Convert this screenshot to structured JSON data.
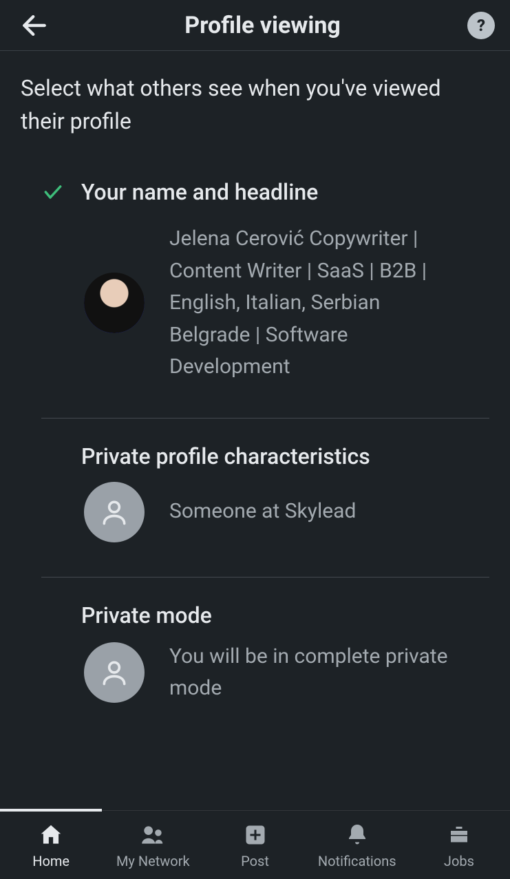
{
  "header": {
    "title": "Profile viewing"
  },
  "subheading": "Select what others see when you've viewed their profile",
  "options": [
    {
      "title": "Your name and headline",
      "selected": true,
      "avatar": "photo",
      "detail": "Jelena Cerović Copywriter | Content Writer | SaaS | B2B | English, Italian, Serbian Belgrade | Software Development"
    },
    {
      "title": "Private profile characteristics",
      "selected": false,
      "avatar": "anon",
      "detail": "Someone at Skylead"
    },
    {
      "title": "Private mode",
      "selected": false,
      "avatar": "anon",
      "detail": "You will be in complete private mode"
    }
  ],
  "nav": {
    "items": [
      {
        "label": "Home",
        "icon": "home",
        "active": true
      },
      {
        "label": "My Network",
        "icon": "network",
        "active": false
      },
      {
        "label": "Post",
        "icon": "post",
        "active": false
      },
      {
        "label": "Notifications",
        "icon": "bell",
        "active": false
      },
      {
        "label": "Jobs",
        "icon": "briefcase",
        "active": false
      }
    ]
  },
  "colors": {
    "bg": "#1d2226",
    "text": "#e6e9ec",
    "muted": "#a3aab0",
    "accent_check": "#3ebd7a",
    "divider": "#444a4f"
  }
}
